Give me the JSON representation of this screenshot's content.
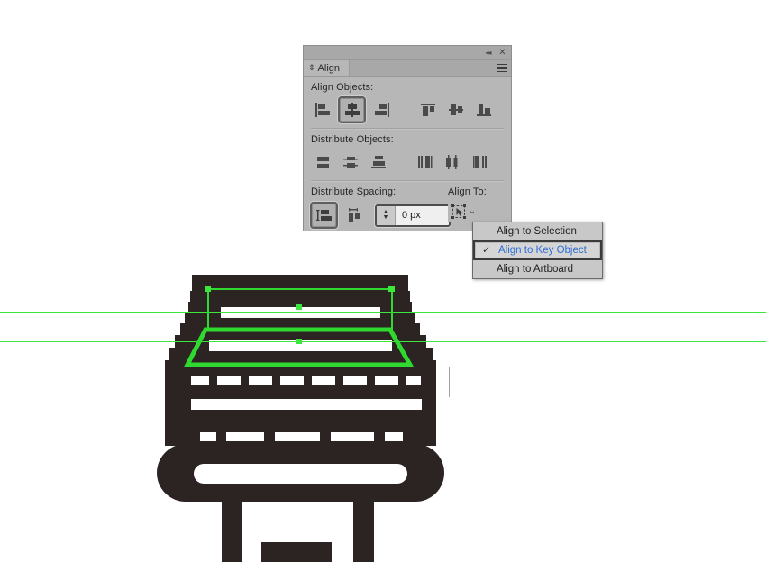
{
  "panel": {
    "title": "Align",
    "tab_glyph": "⇕",
    "titlebar": {
      "collapse_icon": "collapse-double-arrow-icon",
      "collapse_glyph": "◂◂",
      "close_icon": "close-icon",
      "close_glyph": "✕",
      "menu_icon": "panel-menu-icon"
    },
    "sections": {
      "align_objects": {
        "label": "Align Objects:",
        "buttons": [
          {
            "name": "horizontal-align-left",
            "pressed": false
          },
          {
            "name": "horizontal-align-center",
            "pressed": true
          },
          {
            "name": "horizontal-align-right",
            "pressed": false
          },
          {
            "name": "vertical-align-top",
            "pressed": false
          },
          {
            "name": "vertical-align-center",
            "pressed": false
          },
          {
            "name": "vertical-align-bottom",
            "pressed": false
          }
        ]
      },
      "distribute_objects": {
        "label": "Distribute Objects:",
        "buttons": [
          {
            "name": "vertical-distribute-top",
            "pressed": false
          },
          {
            "name": "vertical-distribute-center",
            "pressed": false
          },
          {
            "name": "vertical-distribute-bottom",
            "pressed": false
          },
          {
            "name": "horizontal-distribute-left",
            "pressed": false
          },
          {
            "name": "horizontal-distribute-center",
            "pressed": false
          },
          {
            "name": "horizontal-distribute-right",
            "pressed": false
          }
        ]
      },
      "distribute_spacing": {
        "label": "Distribute Spacing:",
        "buttons": [
          {
            "name": "vertical-distribute-space",
            "pressed": true
          },
          {
            "name": "horizontal-distribute-space",
            "pressed": false
          }
        ],
        "input": {
          "value": "0 px",
          "placeholder": "0 px",
          "stepper_up": "▲",
          "stepper_down": "▼"
        }
      },
      "align_to": {
        "label": "Align To:",
        "button_icon": "align-to-key-object-icon",
        "chevron": "⌄"
      }
    }
  },
  "dropdown": {
    "check_glyph": "✓",
    "items": [
      {
        "label": "Align to Selection",
        "selected": false,
        "checked": false
      },
      {
        "label": "Align to Key Object",
        "selected": true,
        "checked": true
      },
      {
        "label": "Align to Artboard",
        "selected": false,
        "checked": false
      }
    ]
  },
  "artwork": {
    "name": "printer-machine-icon-illustration",
    "shape_color": "#2B2422",
    "selection_color": "#2FD92F",
    "guide_color": "#3DE63D",
    "selected_objects": [
      {
        "name": "upper-rectangle-selection",
        "is_key_object": false
      },
      {
        "name": "lower-trapezoid-selection",
        "is_key_object": true
      }
    ],
    "guides": [
      {
        "name": "horizontal-guide-upper"
      },
      {
        "name": "horizontal-guide-lower"
      }
    ]
  }
}
